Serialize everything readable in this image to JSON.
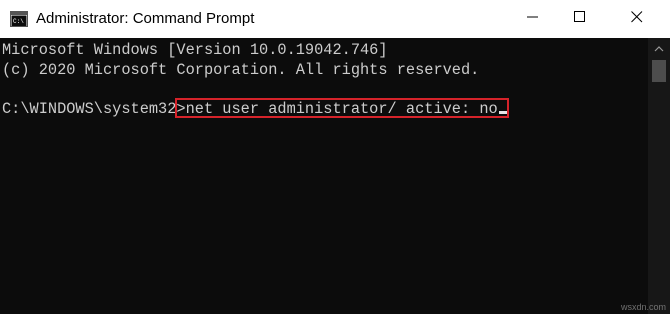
{
  "window": {
    "title": "Administrator: Command Prompt",
    "icon": "cmd-icon",
    "controls": {
      "minimize": "minimize-icon",
      "maximize": "maximize-icon",
      "close": "close-icon"
    }
  },
  "console": {
    "line1": "Microsoft Windows [Version 10.0.19042.746]",
    "line2": "(c) 2020 Microsoft Corporation. All rights reserved.",
    "prompt": "C:\\WINDOWS\\system32>",
    "command": "net user administrator/ active: no"
  },
  "colors": {
    "background": "#0c0c0c",
    "text": "#cccccc",
    "highlight": "#d6232a"
  },
  "watermark": "wsxdn.com"
}
